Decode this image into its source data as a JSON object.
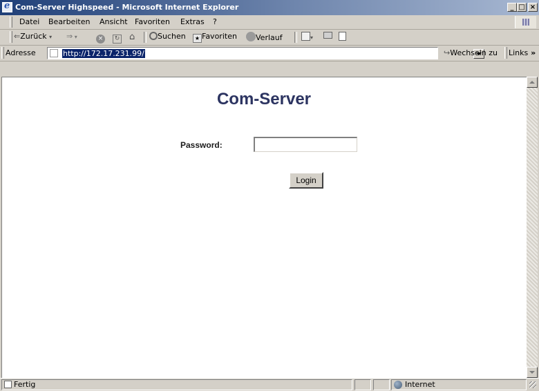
{
  "window": {
    "title": "Com-Server Highspeed - Microsoft Internet Explorer",
    "controls": [
      "_",
      "□",
      "×"
    ]
  },
  "menu": [
    "Datei",
    "Bearbeiten",
    "Ansicht",
    "Favoriten",
    "Extras",
    "?"
  ],
  "toolbar": {
    "back_label": "Zurück",
    "search_label": "Suchen",
    "favorites_label": "Favoriten",
    "history_label": "Verlauf"
  },
  "address": {
    "label": "Adresse",
    "url": "http://172.17.231.99/",
    "go_label": "Wechseln zu",
    "links_label": "Links"
  },
  "page": {
    "title": "Com-Server",
    "password_label": "Password:",
    "password_value": "",
    "login_label": "Login"
  },
  "status": {
    "text": "Fertig",
    "zone": "Internet"
  },
  "icons": {
    "app": "ie-icon",
    "back": "back-arrow-icon",
    "forward": "forward-arrow-icon",
    "stop": "stop-icon",
    "refresh": "refresh-icon",
    "home": "home-icon",
    "search": "search-icon",
    "favorites": "favorites-icon",
    "history": "history-icon",
    "mail": "mail-icon",
    "print": "print-icon",
    "edit": "edit-icon",
    "go": "go-arrow-icon",
    "page": "page-icon",
    "zone": "globe-icon"
  }
}
